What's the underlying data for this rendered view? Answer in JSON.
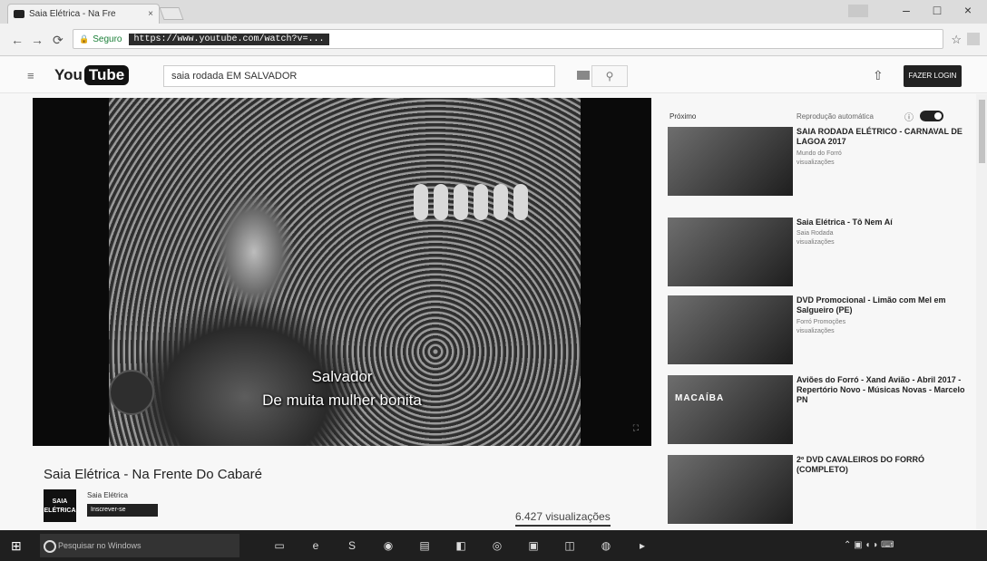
{
  "browser": {
    "tab_title": "Saia Elétrica - Na Fre",
    "tab_close": "×",
    "window_controls": {
      "minimize": "–",
      "maximize": "□",
      "close": "×"
    },
    "security_label": "Seguro",
    "url": "https://www.youtube.com/watch?v=..."
  },
  "youtube": {
    "logo_you": "You",
    "logo_tube": "Tube",
    "search_value": "saia rodada EM SALVADOR",
    "signin_label": "FAZER LOGIN"
  },
  "player": {
    "subtitle_line1": "Salvador",
    "subtitle_line2": "De muita mulher bonita"
  },
  "video": {
    "title": "Saia Elétrica - Na Frente Do Cabaré",
    "channel_avatar_line1": "SAIA",
    "channel_avatar_line2": "ELÉTRICA",
    "channel_name": "Saia Elétrica",
    "subscribe_label": "Inscrever-se",
    "views": "6.427 visualizações"
  },
  "sidebar": {
    "upnext_label": "Próximo",
    "autoplay_label": "Reprodução automática",
    "recommendations": [
      {
        "title": "SAIA RODADA ELÉTRICO - CARNAVAL DE LAGOA 2017",
        "channel": "Mundo do Forró",
        "views": "visualizações",
        "duration": "",
        "thumb_text": ""
      },
      {
        "title": "Saia Elétrica - Tô Nem Aí",
        "channel": "Saia Rodada",
        "views": "visualizações",
        "duration": "",
        "thumb_text": ""
      },
      {
        "title": "DVD Promocional - Limão com Mel em Salgueiro (PE)",
        "channel": "Forró Promoções",
        "views": "visualizações",
        "duration": "",
        "thumb_text": ""
      },
      {
        "title": "Aviões do Forró - Xand Avião - Abril 2017 - Repertório Novo - Músicas Novas - Marcelo PN",
        "channel": "",
        "views": "",
        "duration": "",
        "thumb_text": "MACAÍBA"
      },
      {
        "title": "2º DVD CAVALEIROS DO FORRÓ (COMPLETO)",
        "channel": "",
        "views": "",
        "duration": "",
        "thumb_text": ""
      }
    ]
  },
  "taskbar": {
    "search_placeholder": "Pesquisar no Windows",
    "clock_time": "",
    "clock_date": ""
  }
}
